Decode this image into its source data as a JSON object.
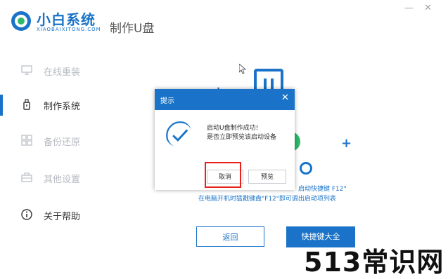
{
  "app": {
    "brand": "小白系统",
    "brand_sub": "XIAOBAIXITONG.COM",
    "page_title": "制作U盘",
    "window": {
      "minimize_symbol": "—",
      "close_symbol": "✕"
    }
  },
  "sidebar": {
    "items": [
      {
        "label": "在线重装",
        "icon": "monitor-icon",
        "state": "inactive"
      },
      {
        "label": "制作系统",
        "icon": "usb-icon",
        "state": "active"
      },
      {
        "label": "备份还原",
        "icon": "grid-icon",
        "state": "inactive"
      },
      {
        "label": "其他设置",
        "icon": "toolbox-icon",
        "state": "inactive"
      },
      {
        "label": "关于帮助",
        "icon": "info-icon",
        "state": "inactive"
      }
    ]
  },
  "main": {
    "hint_line1": "启动快捷键 F12\"",
    "hint_line2": "在电脑开机时猛戳键盘\"F12\"即可调出启动项列表",
    "back_label": "返回",
    "shortcut_label": "快捷键大全"
  },
  "dialog": {
    "title": "提示",
    "message_line1": "启动U盘制作成功!",
    "message_line2": "是否立即预览该启动设备",
    "cancel_label": "取消",
    "preview_label": "预览"
  },
  "watermark": "513常识网",
  "colors": {
    "accent": "#1a73c8",
    "highlight": "#e8211a",
    "green": "#2fb86c"
  }
}
